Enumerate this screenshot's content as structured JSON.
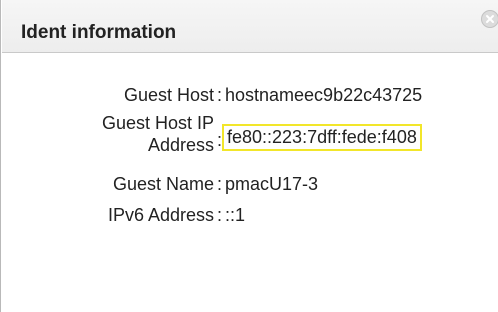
{
  "panel": {
    "title": "Ident information"
  },
  "fields": [
    {
      "label": "Guest Host",
      "colon": ":",
      "value": "hostnameec9b22c43725"
    },
    {
      "label": "Guest Host IP Address",
      "colon": ":",
      "value": "fe80::223:7dff:fede:f408"
    },
    {
      "label": "Guest Name",
      "colon": ":",
      "value": "pmacU17-3"
    },
    {
      "label": "IPv6 Address",
      "colon": ":",
      "value": "::1"
    }
  ],
  "icons": {
    "close": "close-circle-icon"
  }
}
